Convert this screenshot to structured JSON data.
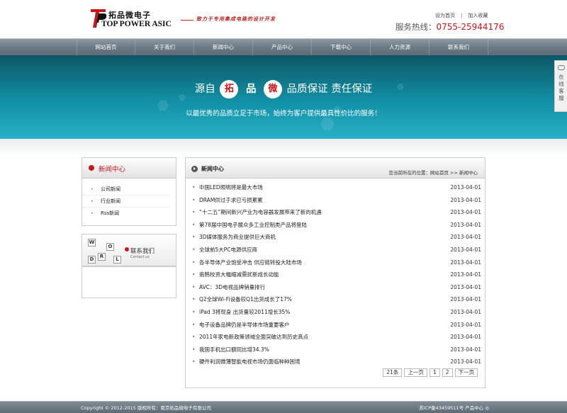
{
  "header": {
    "logo_cn": "拓品微电子",
    "logo_en": "TOP POWER ASIC",
    "slogan": "致力于专用集成电路的设计开发",
    "links": [
      "设为首页",
      "加入收藏"
    ],
    "hotline_label": "服务热线：",
    "hotline_number": "0755-25944176"
  },
  "nav": [
    "网站首页",
    "关于我们",
    "新闻中心",
    "产品中心",
    "下载中心",
    "人力资源",
    "联系我们"
  ],
  "banner": {
    "prefix": "源自",
    "circle1": "拓",
    "mid": "品",
    "circle2": "微",
    "suffix": "品质保证  责任保证",
    "sub": "以最优秀的品质立足于市场，始终为客户提供最具性价比的服务！"
  },
  "sidebar": {
    "title": "新闻中心",
    "items": [
      "公司新闻",
      "行业新闻",
      "Rss新闻"
    ],
    "contact_label": "联系我们",
    "contact_en": "Contact us",
    "contact_letters": [
      "W",
      "O",
      "R",
      "L",
      "D"
    ]
  },
  "main": {
    "title": "新闻中心",
    "breadcrumb": "您当前所在的位置：网站首页 >> 新闻中心",
    "news": [
      {
        "title": "中国LED照明将是最大市场",
        "date": "2013-04-01"
      },
      {
        "title": "DRAM供过于求已亏损累累",
        "date": "2013-04-01"
      },
      {
        "title": "“十二五”期间新兴产业为电容器发展带来了新的机遇",
        "date": "2013-04-01"
      },
      {
        "title": "第78届中国电子展众多工业控制类产品将登陆",
        "date": "2013-04-01"
      },
      {
        "title": "3D媒体服务为商业提供巨大商机",
        "date": "2013-04-01"
      },
      {
        "title": "全球前5大PC电源供应商",
        "date": "2013-04-01"
      },
      {
        "title": "各半导体产业饱受冲击 供应链转投大陆市场",
        "date": "2013-04-01"
      },
      {
        "title": "南韩校资大幅缩减需扰新成长动能",
        "date": "2013-04-01"
      },
      {
        "title": "AVC：3D电视品牌销量排行",
        "date": "2013-04-01"
      },
      {
        "title": "Q2全球Wi-Fi设备较Q1出货成长了17%",
        "date": "2013-04-01"
      },
      {
        "title": "iPad 3将现身 出货量较2011增长35%",
        "date": "2013-04-01"
      },
      {
        "title": "电子设备品牌仍是半导体市场重要客户",
        "date": "2013-04-01"
      },
      {
        "title": "2011年家电新政策领域全面突破达到历史高点",
        "date": "2013-04-01"
      },
      {
        "title": "我国手机出口额同比增34.3%",
        "date": "2013-04-01"
      },
      {
        "title": "硬件利润微薄智能电视市场仍面临种种困境",
        "date": "2013-04-01"
      }
    ],
    "pager": {
      "count": "21条",
      "prev": "上一页",
      "pages": [
        "1",
        "2"
      ],
      "next": "下一页"
    }
  },
  "service": {
    "label": "在线客服"
  },
  "footer": {
    "left": "Copyright © 2012-2015 版权所有：南京拓品微电子有限公司",
    "right": "苏ICP备43459511号 产品中心 ◎"
  },
  "colors": {
    "brand_red": "#c8161d",
    "banner_teal": "#1290a6",
    "nav_gray": "#6c7a85"
  }
}
